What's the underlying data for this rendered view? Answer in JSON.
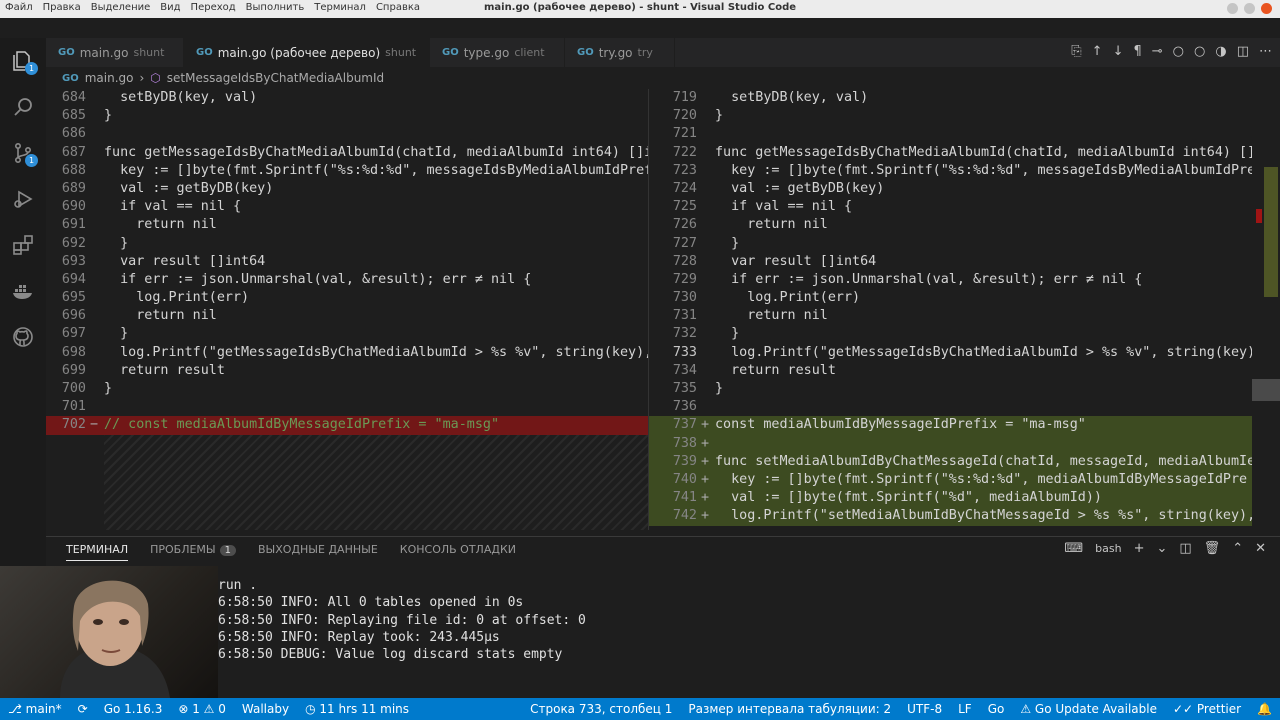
{
  "window": {
    "title": "main.go (рабочее дерево) - shunt - Visual Studio Code",
    "menu": [
      "Файл",
      "Правка",
      "Выделение",
      "Вид",
      "Переход",
      "Выполнить",
      "Терминал",
      "Справка"
    ]
  },
  "activity_bar": {
    "explorer_badge": "1",
    "scm_badge": "1"
  },
  "tabs": [
    {
      "label": "main.go",
      "desc": "shunt"
    },
    {
      "label": "main.go (рабочее дерево)",
      "desc": "shunt"
    },
    {
      "label": "type.go",
      "desc": "client"
    },
    {
      "label": "try.go",
      "desc": "try"
    }
  ],
  "breadcrumb": {
    "file": "main.go",
    "symbol": "setMessageIdsByChatMediaAlbumId"
  },
  "left_pane": [
    {
      "n": "684",
      "m": "",
      "t": "  setByDB(key, val)"
    },
    {
      "n": "685",
      "m": "",
      "t": "}"
    },
    {
      "n": "686",
      "m": "",
      "t": ""
    },
    {
      "n": "687",
      "m": "",
      "t": "func getMessageIdsByChatMediaAlbumId(chatId, mediaAlbumId int64) []i"
    },
    {
      "n": "688",
      "m": "",
      "t": "  key := []byte(fmt.Sprintf(\"%s:%d:%d\", messageIdsByMediaAlbumIdPref"
    },
    {
      "n": "689",
      "m": "",
      "t": "  val := getByDB(key)"
    },
    {
      "n": "690",
      "m": "",
      "t": "  if val == nil {"
    },
    {
      "n": "691",
      "m": "",
      "t": "    return nil"
    },
    {
      "n": "692",
      "m": "",
      "t": "  }"
    },
    {
      "n": "693",
      "m": "",
      "t": "  var result []int64"
    },
    {
      "n": "694",
      "m": "",
      "t": "  if err := json.Unmarshal(val, &result); err ≠ nil {"
    },
    {
      "n": "695",
      "m": "",
      "t": "    log.Print(err)"
    },
    {
      "n": "696",
      "m": "",
      "t": "    return nil"
    },
    {
      "n": "697",
      "m": "",
      "t": "  }"
    },
    {
      "n": "698",
      "m": "",
      "t": "  log.Printf(\"getMessageIdsByChatMediaAlbumId > %s %v\", string(key),"
    },
    {
      "n": "699",
      "m": "",
      "t": "  return result"
    },
    {
      "n": "700",
      "m": "",
      "t": "}"
    },
    {
      "n": "701",
      "m": "",
      "t": ""
    },
    {
      "n": "702",
      "m": "−",
      "t": "// const mediaAlbumIdByMessageIdPrefix = \"ma-msg\""
    }
  ],
  "right_pane": [
    {
      "n": "719",
      "m": "",
      "t": "  setByDB(key, val)"
    },
    {
      "n": "720",
      "m": "",
      "t": "}"
    },
    {
      "n": "721",
      "m": "",
      "t": ""
    },
    {
      "n": "722",
      "m": "",
      "t": "func getMessageIdsByChatMediaAlbumId(chatId, mediaAlbumId int64) []"
    },
    {
      "n": "723",
      "m": "",
      "t": "  key := []byte(fmt.Sprintf(\"%s:%d:%d\", messageIdsByMediaAlbumIdPre"
    },
    {
      "n": "724",
      "m": "",
      "t": "  val := getByDB(key)"
    },
    {
      "n": "725",
      "m": "",
      "t": "  if val == nil {"
    },
    {
      "n": "726",
      "m": "",
      "t": "    return nil"
    },
    {
      "n": "727",
      "m": "",
      "t": "  }"
    },
    {
      "n": "728",
      "m": "",
      "t": "  var result []int64"
    },
    {
      "n": "729",
      "m": "",
      "t": "  if err := json.Unmarshal(val, &result); err ≠ nil {"
    },
    {
      "n": "730",
      "m": "",
      "t": "    log.Print(err)"
    },
    {
      "n": "731",
      "m": "",
      "t": "    return nil"
    },
    {
      "n": "732",
      "m": "",
      "t": "  }"
    },
    {
      "n": "733",
      "m": "",
      "t": "  log.Printf(\"getMessageIdsByChatMediaAlbumId > %s %v\", string(key),"
    },
    {
      "n": "734",
      "m": "",
      "t": "  return result"
    },
    {
      "n": "735",
      "m": "",
      "t": "}"
    },
    {
      "n": "736",
      "m": "",
      "t": ""
    },
    {
      "n": "737",
      "m": "+",
      "t": "const mediaAlbumIdByMessageIdPrefix = \"ma-msg\""
    },
    {
      "n": "738",
      "m": "+",
      "t": ""
    },
    {
      "n": "739",
      "m": "+",
      "t": "func setMediaAlbumIdByChatMessageId(chatId, messageId, mediaAlbumIe"
    },
    {
      "n": "740",
      "m": "+",
      "t": "  key := []byte(fmt.Sprintf(\"%s:%d:%d\", mediaAlbumIdByMessageIdPre"
    },
    {
      "n": "741",
      "m": "+",
      "t": "  val := []byte(fmt.Sprintf(\"%d\", mediaAlbumId))"
    },
    {
      "n": "742",
      "m": "+",
      "t": "  log.Printf(\"setMediaAlbumIdByChatMessageId > %s %s\", string(key),"
    }
  ],
  "panel": {
    "tabs": [
      "ТЕРМИНАЛ",
      "ПРОБЛЕМЫ",
      "ВЫХОДНЫЕ ДАННЫЕ",
      "КОНСОЛЬ ОТЛАДКИ"
    ],
    "problems_count": "1",
    "shell": "bash",
    "terminal_lines": [
      "run .",
      "6:58:50 INFO: All 0 tables opened in 0s",
      "6:58:50 INFO: Replaying file id: 0 at offset: 0",
      "6:58:50 INFO: Replay took: 243.445µs",
      "6:58:50 DEBUG: Value log discard stats empty"
    ]
  },
  "statusbar": {
    "branch": "main*",
    "go_version": "Go 1.16.3",
    "errors": "1",
    "warnings": "0",
    "wallaby": "Wallaby",
    "timer": "11 hrs 11 mins",
    "position": "Строка 733, столбец 1",
    "tab_size": "Размер интервала табуляции: 2",
    "encoding": "UTF-8",
    "eol": "LF",
    "language": "Go",
    "go_update": "Go Update Available",
    "prettier": "Prettier"
  },
  "colors": {
    "accent": "#007acc",
    "deleted_line": "#a01414",
    "added_line": "#78a028"
  }
}
